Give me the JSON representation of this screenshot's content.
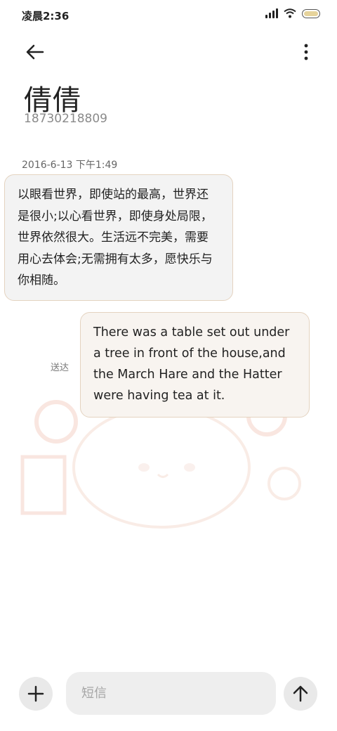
{
  "status_bar": {
    "time": "凌晨2:36",
    "icons": [
      "signal-icon",
      "wifi-icon",
      "battery-icon"
    ]
  },
  "header": {
    "back_icon": "back-arrow-icon",
    "menu_icon": "more-vertical-icon",
    "contact_name": "倩倩",
    "contact_number": "18730218809"
  },
  "conversation": {
    "timestamp": "2016-6-13 下午1:49",
    "incoming_message": "以眼看世界，即使站的最高，世界还是很小;以心看世界，即使身处局限，世界依然很大。生活远不完美，需要用心去体会;无需拥有太多，愿快乐与你相随。",
    "outgoing_message": "There was a table set out under a tree in front of the house,and the March Hare and the Hatter were having tea at it.",
    "outgoing_status": "送达"
  },
  "composer": {
    "add_icon": "plus-icon",
    "placeholder": "短信",
    "value": "",
    "send_icon": "arrow-up-icon"
  },
  "colors": {
    "bubble_border": "#e4d3c0",
    "incoming_bg": "#f3f3f3",
    "outgoing_bg": "#f8f4f0",
    "watermark": "#f0c9b8"
  }
}
